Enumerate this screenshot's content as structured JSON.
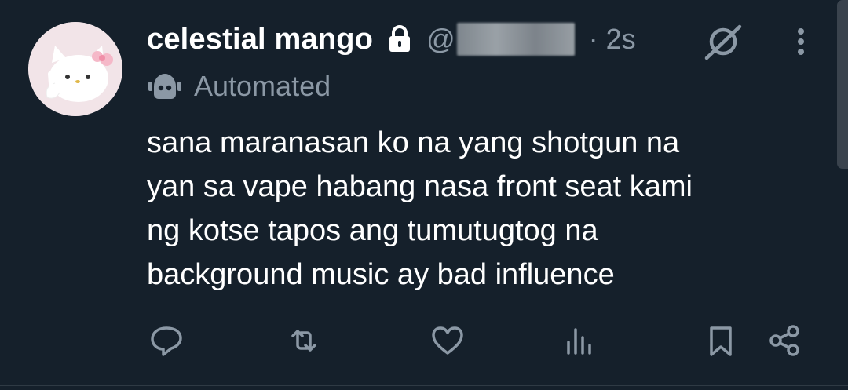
{
  "tweet": {
    "display_name": "celestial mango",
    "handle_prefix": "@",
    "time": "· 2s",
    "automated_label": "Automated",
    "body_lines": [
      "sana maranasan ko na yang shotgun na",
      "yan sa vape habang nasa front seat kami",
      "ng kotse tapos ang tumutugtog na",
      "background music ay bad influence"
    ]
  },
  "icons": {
    "lock": "lock-icon",
    "grok": "grok-icon",
    "more": "more-vertical-icon",
    "bot": "bot-icon",
    "reply": "reply-icon",
    "repost": "repost-icon",
    "like": "like-icon",
    "views": "views-icon",
    "bookmark": "bookmark-icon",
    "share": "share-icon"
  },
  "colors": {
    "background": "#15202b",
    "text": "#ffffff",
    "secondary": "#8b98a5"
  }
}
